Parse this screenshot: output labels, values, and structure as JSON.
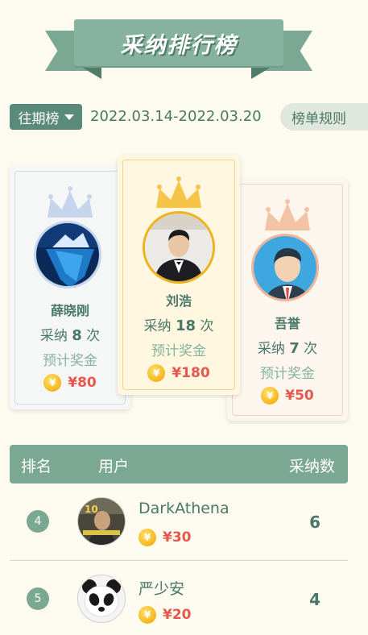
{
  "banner": {
    "title": "采纳排行榜"
  },
  "period": {
    "button_label": "往期榜",
    "date_range": "2022.03.14-2022.03.20"
  },
  "rules": {
    "label": "榜单规则"
  },
  "podium": {
    "adopt_prefix": "采纳",
    "adopt_suffix": "次",
    "bonus_label": "预计奖金",
    "first": {
      "name": "刘浩",
      "count": "18",
      "prize": "¥180"
    },
    "second": {
      "name": "薛晓刚",
      "count": "8",
      "prize": "¥80"
    },
    "third": {
      "name": "吾誉",
      "count": "7",
      "prize": "¥50"
    }
  },
  "table": {
    "headers": {
      "rank": "排名",
      "user": "用户",
      "count": "采纳数"
    },
    "rows": [
      {
        "rank": "4",
        "name": "DarkAthena",
        "prize": "¥30",
        "count": "6"
      },
      {
        "rank": "5",
        "name": "严少安",
        "prize": "¥20",
        "count": "4"
      }
    ]
  },
  "coin_glyph": "¥",
  "colors": {
    "accent": "#7aa893",
    "dark_accent": "#5a8a7a",
    "background": "#fdfbef",
    "prize": "#e8574b",
    "gold": "#f5b51c"
  }
}
